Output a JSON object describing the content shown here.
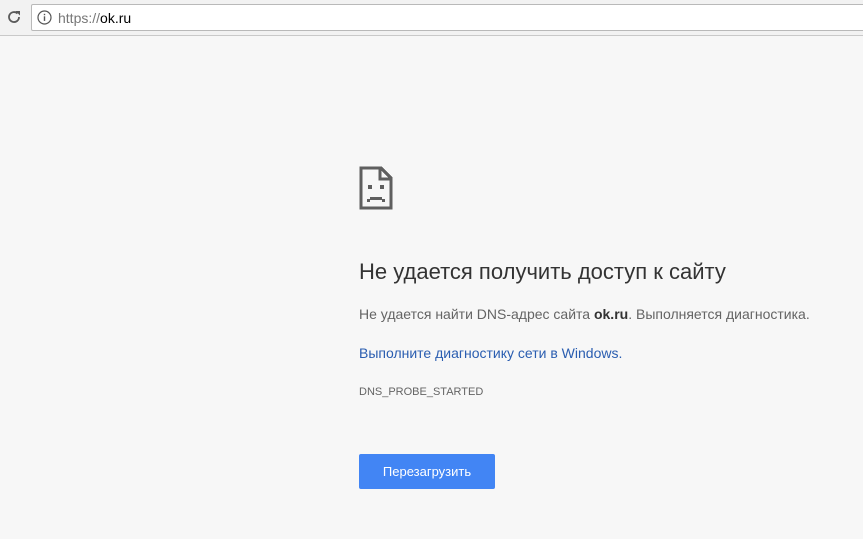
{
  "browser": {
    "url_scheme": "https://",
    "url_host": "ok.ru"
  },
  "error_page": {
    "title": "Не удается получить доступ к сайту",
    "description_before": "Не удается найти DNS-адрес сайта ",
    "description_host": "ok.ru",
    "description_after": ". Выполняется диагностика.",
    "diagnostics_link": "Выполните диагностику сети в Windows.",
    "error_code": "DNS_PROBE_STARTED",
    "reload_button_label": "Перезагрузить"
  },
  "colors": {
    "page_background": "#f7f7f7",
    "link": "#2a5db0",
    "button": "#4285f4"
  },
  "icons": {
    "reload": "reload-icon",
    "info": "info-icon",
    "error": "sad-page-icon"
  }
}
